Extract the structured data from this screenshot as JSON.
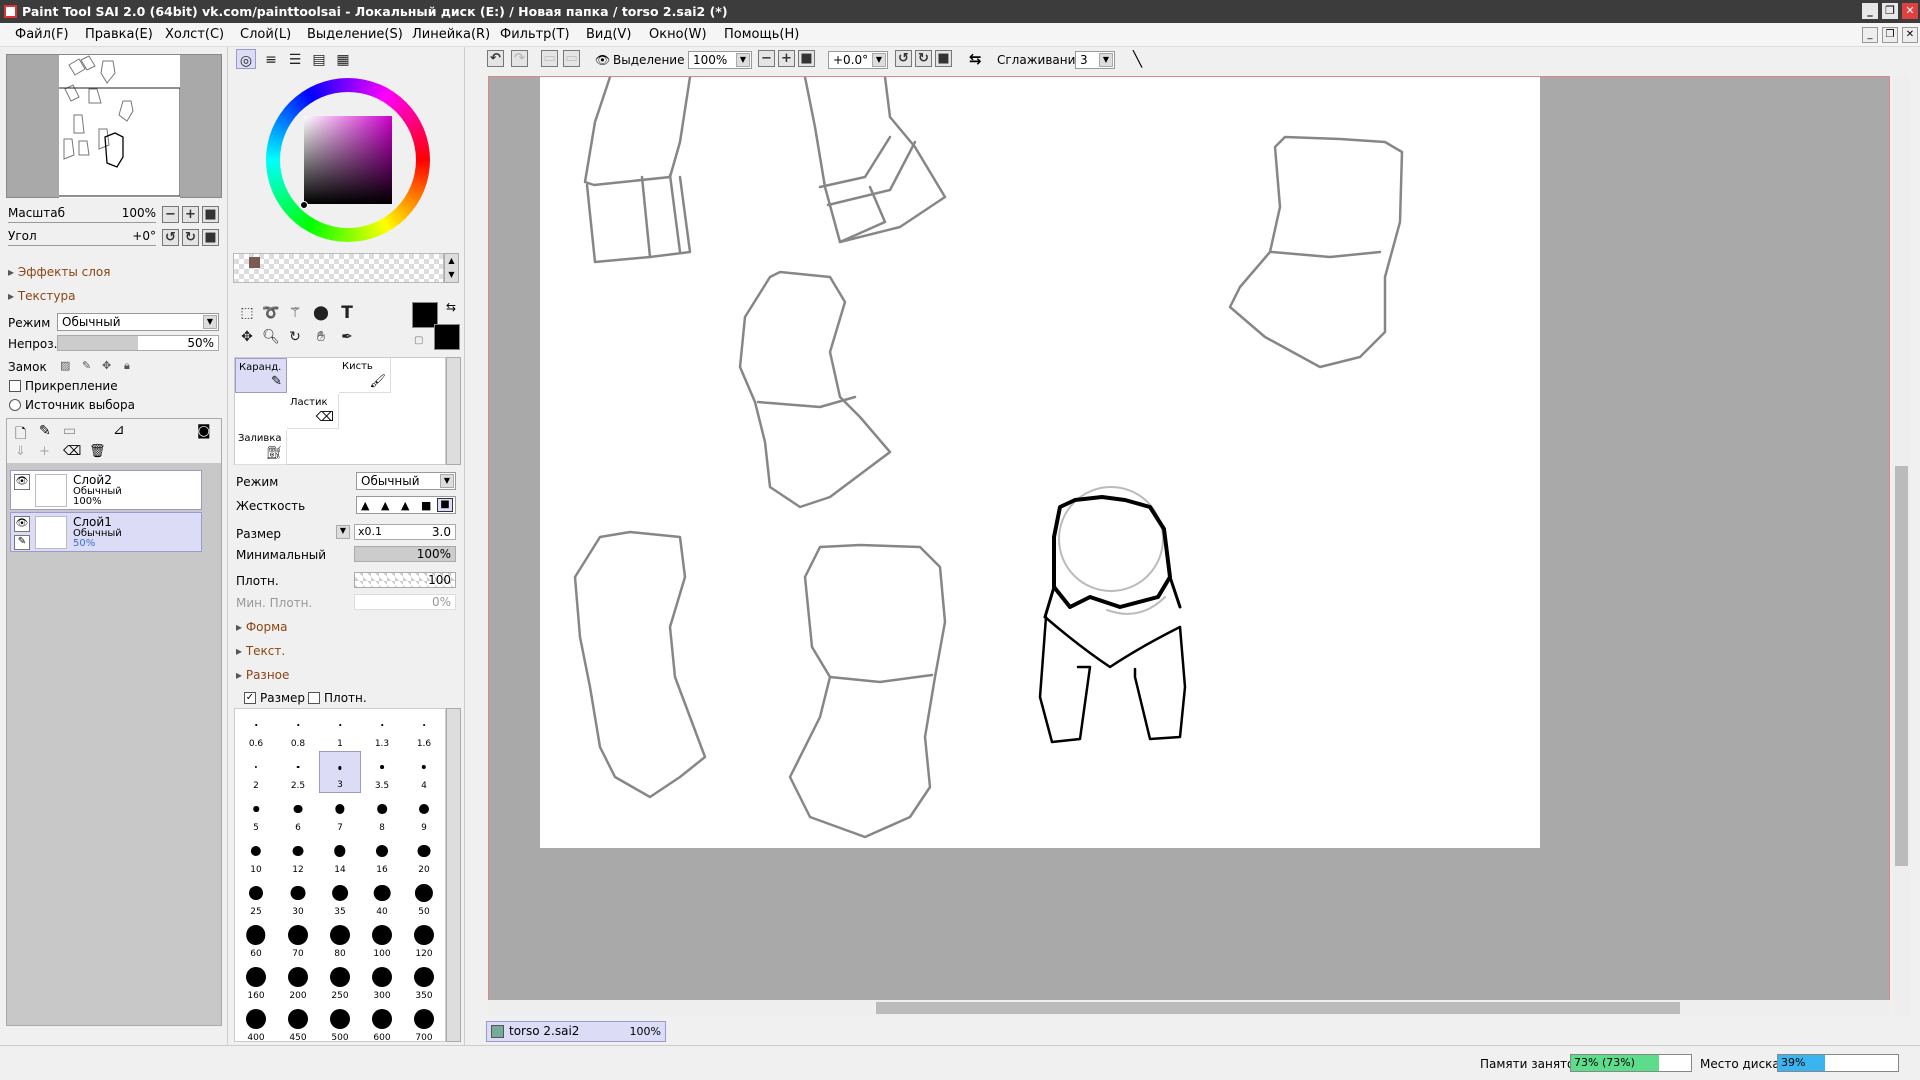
{
  "title": "Paint Tool SAI 2.0 (64bit) vk.com/painttoolsai - Локальный диск (E:) / Новая папка / torso 2.sai2 (*)",
  "menu": [
    "Файл(F)",
    "Правка(E)",
    "Холст(C)",
    "Слой(L)",
    "Выделение(S)",
    "Линейка(R)",
    "Фильтр(T)",
    "Вид(V)",
    "Окно(W)",
    "Помощь(H)"
  ],
  "navigator": {
    "zoom_label": "Масштаб",
    "zoom_value": "100%",
    "angle_label": "Угол",
    "angle_value": "+0°"
  },
  "layer_panel": {
    "effects_label": "Эффекты слоя",
    "texture_label": "Текстура",
    "mode_label": "Режим",
    "mode_value": "Обычный",
    "opacity_label": "Непроз.",
    "opacity_value": "50%",
    "lock_label": "Замок",
    "clip_label": "Прикрепление",
    "source_label": "Источник выбора",
    "layers": [
      {
        "name": "Слой2",
        "mode": "Обычный",
        "opacity": "100%"
      },
      {
        "name": "Слой1",
        "mode": "Обычный",
        "opacity": "50%"
      }
    ]
  },
  "tools": {
    "slots": [
      "Каранд.",
      "Кисть",
      "Ластик",
      "Заливка"
    ],
    "mode_label": "Режим",
    "mode_value": "Обычный",
    "hardness_label": "Жесткость",
    "size_label": "Размер",
    "size_mult": "x0.1",
    "size_value": "3.0",
    "min_label": "Минимальный",
    "min_value": "100%",
    "density_label": "Плотн.",
    "density_value": "100",
    "min_density_label": "Мин. Плотн.",
    "min_density_value": "0%",
    "section_shape": "Форма",
    "section_text": "Текст.",
    "section_misc": "Разное",
    "chk_size": "Размер",
    "chk_density": "Плотн.",
    "brush_sizes": [
      "0.6",
      "0.8",
      "1",
      "1.3",
      "1.6",
      "2",
      "2.5",
      "3",
      "3.5",
      "4",
      "5",
      "6",
      "7",
      "8",
      "9",
      "10",
      "12",
      "14",
      "16",
      "20",
      "25",
      "30",
      "35",
      "40",
      "50",
      "60",
      "70",
      "80",
      "100",
      "120",
      "160",
      "200",
      "250",
      "300",
      "350",
      "400",
      "450",
      "500",
      "600",
      "700"
    ],
    "selected_size": "3"
  },
  "toolbar": {
    "selection_label": "Выделение",
    "zoom_value": "100%",
    "angle_value": "+0.0°",
    "smoothing_label": "Сглаживание",
    "smoothing_value": "3"
  },
  "document_tab": {
    "name": "torso 2.sai2",
    "zoom": "100%"
  },
  "status": {
    "memory_label": "Памяти занято",
    "memory_value": "73% (73%)",
    "memory_fraction": 0.73,
    "disk_label": "Место диска",
    "disk_value": "39%",
    "disk_fraction": 0.39
  },
  "colors": {
    "accent": "#dcdcf7",
    "memory_bar": "#5ddc8c",
    "disk_bar": "#3cb4f0",
    "titlebar": "#3c3c3c"
  }
}
